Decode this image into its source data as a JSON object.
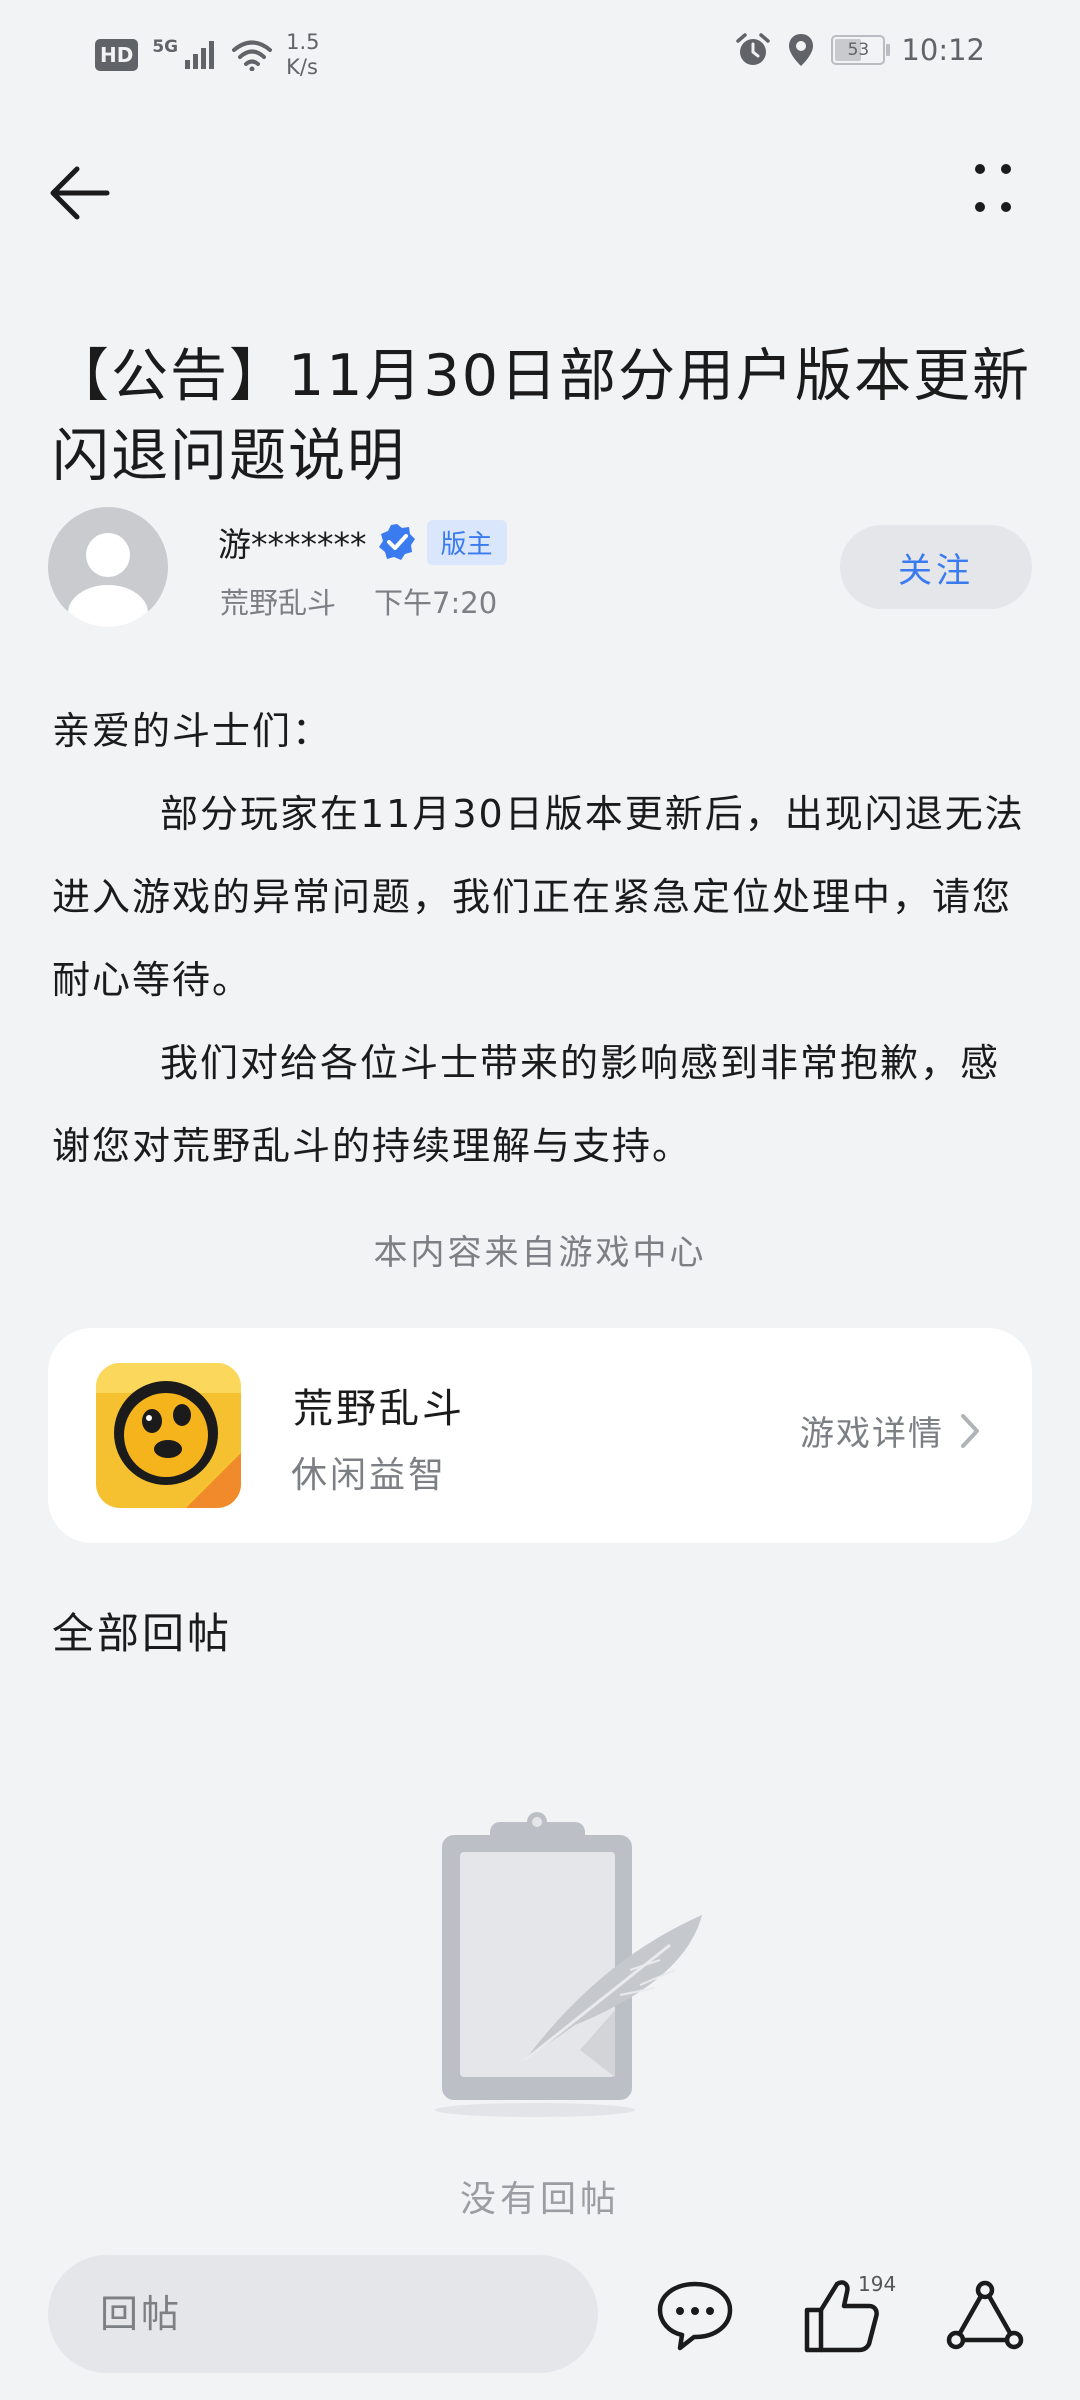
{
  "status_bar": {
    "hd": "HD",
    "network": "5G",
    "speed_value": "1.5",
    "speed_unit": "K/s",
    "battery": "53",
    "time": "10:12",
    "icons": [
      "signal-icon",
      "wifi-icon",
      "alarm-icon",
      "location-icon",
      "battery-icon"
    ]
  },
  "header": {
    "back_icon": "back-arrow-icon",
    "more_icon": "more-icon"
  },
  "post": {
    "title": "【公告】11月30日部分用户版本更新闪退问题说明",
    "author": {
      "name": "游*******",
      "verified_icon": "verified-icon",
      "badge": "版主",
      "forum": "荒野乱斗",
      "time": "下午7:20"
    },
    "follow_label": "关注",
    "paragraphs": [
      "亲爱的斗士们：",
      "部分玩家在11月30日版本更新后，出现闪退无法进入游戏的异常问题，我们正在紧急定位处理中，请您耐心等待。",
      "我们对给各位斗士带来的影响感到非常抱歉，感谢您对荒野乱斗的持续理解与支持。"
    ],
    "source_note": "本内容来自游戏中心"
  },
  "game_card": {
    "name": "荒野乱斗",
    "genre": "休闲益智",
    "detail_label": "游戏详情",
    "accent_color": "#f6c130"
  },
  "replies": {
    "section_title": "全部回帖",
    "empty_text": "没有回帖"
  },
  "bottom_bar": {
    "reply_placeholder": "回帖",
    "like_count": "194",
    "icons": [
      "comment-icon",
      "like-icon",
      "share-icon"
    ]
  },
  "colors": {
    "background": "#f1f3f5",
    "accent_blue": "#3a7bf0",
    "muted_text": "#7c7f84"
  }
}
